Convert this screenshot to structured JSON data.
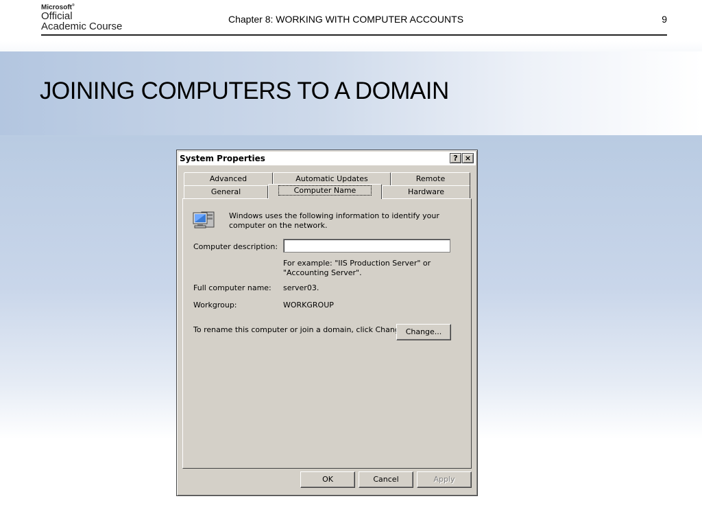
{
  "slide": {
    "logo_line1": "Microsoft",
    "logo_line2": "Official",
    "logo_line3": "Academic Course",
    "chapter": "Chapter 8: WORKING WITH COMPUTER ACCOUNTS",
    "page_number": "9",
    "title": "JOINING COMPUTERS TO A DOMAIN"
  },
  "dialog": {
    "title": "System Properties",
    "help_button": "?",
    "close_button": "×",
    "tabs_row1": [
      "Advanced",
      "Automatic Updates",
      "Remote"
    ],
    "tabs_row2": [
      "General",
      "Computer Name",
      "Hardware"
    ],
    "active_tab": "Computer Name",
    "info_text": "Windows uses the following information to identify your computer on the network.",
    "description_label": "Computer description:",
    "description_value": "",
    "example_text": "For example: \"IIS Production Server\" or \"Accounting Server\".",
    "full_name_label": "Full computer name:",
    "full_name_value": "server03.",
    "workgroup_label": "Workgroup:",
    "workgroup_value": "WORKGROUP",
    "rename_text": "To rename this computer or join a domain, click Change.",
    "change_button": "Change...",
    "ok_button": "OK",
    "cancel_button": "Cancel",
    "apply_button": "Apply"
  },
  "icons": {
    "computer": "network-computer-icon"
  }
}
